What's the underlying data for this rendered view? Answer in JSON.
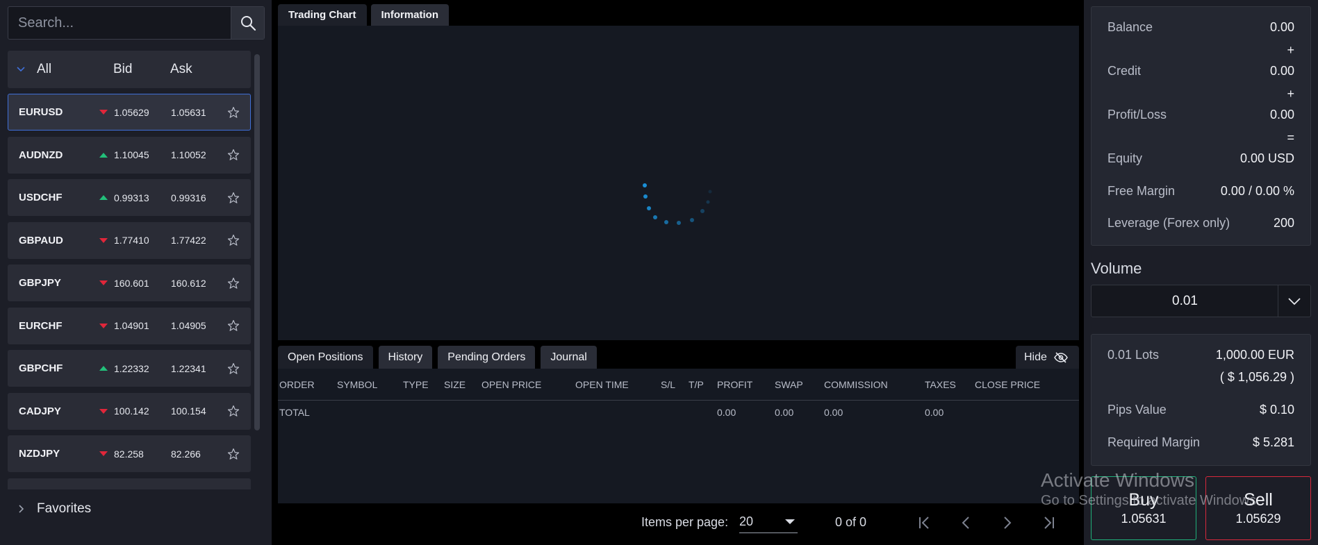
{
  "search": {
    "placeholder": "Search..."
  },
  "list_header": {
    "all": "All",
    "bid": "Bid",
    "ask": "Ask"
  },
  "symbols": [
    {
      "name": "EURUSD",
      "dir": "down",
      "bid": "1.05629",
      "ask": "1.05631"
    },
    {
      "name": "AUDNZD",
      "dir": "up",
      "bid": "1.10045",
      "ask": "1.10052"
    },
    {
      "name": "USDCHF",
      "dir": "up",
      "bid": "0.99313",
      "ask": "0.99316"
    },
    {
      "name": "GBPAUD",
      "dir": "down",
      "bid": "1.77410",
      "ask": "1.77422"
    },
    {
      "name": "GBPJPY",
      "dir": "down",
      "bid": "160.601",
      "ask": "160.612"
    },
    {
      "name": "EURCHF",
      "dir": "down",
      "bid": "1.04901",
      "ask": "1.04905"
    },
    {
      "name": "GBPCHF",
      "dir": "up",
      "bid": "1.22332",
      "ask": "1.22341"
    },
    {
      "name": "CADJPY",
      "dir": "down",
      "bid": "100.142",
      "ask": "100.154"
    },
    {
      "name": "NZDJPY",
      "dir": "down",
      "bid": "82.258",
      "ask": "82.266"
    }
  ],
  "favorites": "Favorites",
  "top_tabs": [
    "Trading Chart",
    "Information"
  ],
  "bottom_tabs": [
    "Open Positions",
    "History",
    "Pending Orders",
    "Journal"
  ],
  "hide_label": "Hide",
  "table": {
    "columns": [
      "ORDER",
      "SYMBOL",
      "TYPE",
      "SIZE",
      "OPEN PRICE",
      "OPEN TIME",
      "S/L",
      "T/P",
      "PROFIT",
      "SWAP",
      "COMMISSION",
      "TAXES",
      "CLOSE PRICE"
    ],
    "total": {
      "label": "TOTAL",
      "profit": "0.00",
      "swap": "0.00",
      "commission": "0.00",
      "taxes": "0.00"
    }
  },
  "pager": {
    "items_per_page_label": "Items per page:",
    "items_per_page": "20",
    "range": "0 of 0"
  },
  "account": {
    "balance_label": "Balance",
    "balance": "0.00",
    "credit_label": "Credit",
    "credit": "0.00",
    "pl_label": "Profit/Loss",
    "pl": "0.00",
    "equity_label": "Equity",
    "equity": "0.00 USD",
    "free_margin_label": "Free Margin",
    "free_margin": "0.00 / 0.00 %",
    "leverage_label": "Leverage (Forex only)",
    "leverage": "200",
    "op_plus": "+",
    "op_equals": "="
  },
  "volume": {
    "label": "Volume",
    "value": "0.01"
  },
  "lots": {
    "lots_label": "0.01 Lots",
    "lots_value": "1,000.00 EUR",
    "lots_usd": "( $ 1,056.29 )",
    "pips_label": "Pips Value",
    "pips_value": "$ 0.10",
    "margin_label": "Required Margin",
    "margin_value": "$ 5.281"
  },
  "buy": {
    "label": "Buy",
    "price": "1.05631"
  },
  "sell": {
    "label": "Sell",
    "price": "1.05629"
  },
  "watermark": {
    "line1": "Activate Windows",
    "line2": "Go to Settings to activate Windows."
  },
  "colors": {
    "accent_blue": "#3f6fd8",
    "up_green": "#22c07a",
    "down_red": "#e0263a",
    "buy_green": "#1fb07a",
    "sell_red": "#d8283c",
    "spinner": "#1a8fd6"
  }
}
